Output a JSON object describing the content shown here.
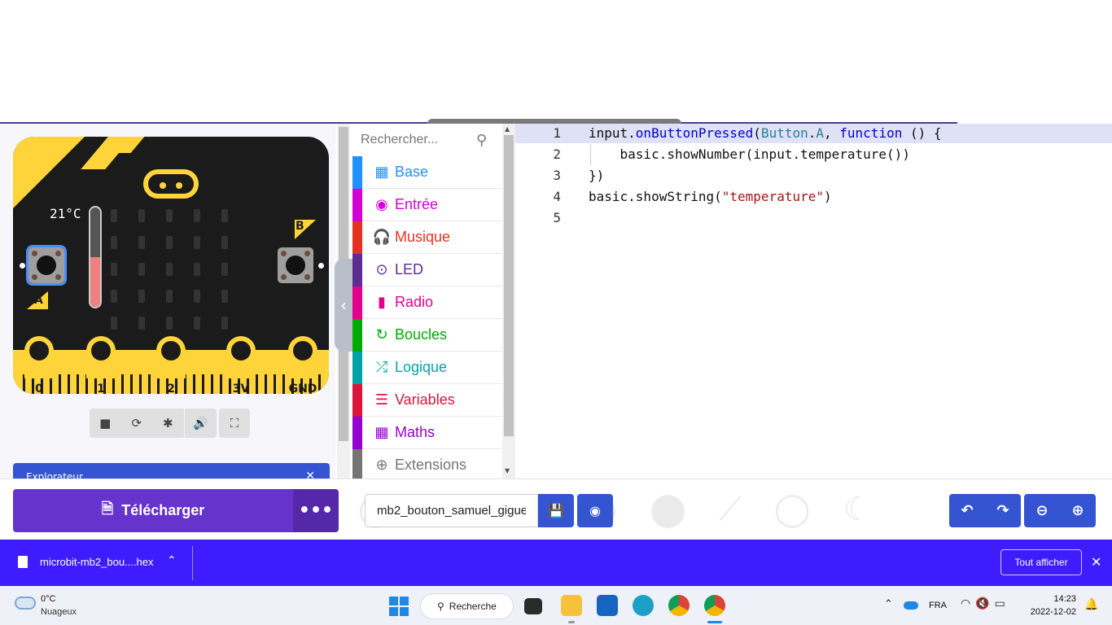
{
  "simulator": {
    "temperature_label": "21°C",
    "temperature_level": 0.5,
    "button_a_letter": "A",
    "button_b_letter": "B",
    "pins": [
      "0",
      "1",
      "2",
      "3V",
      "GND"
    ],
    "explorer_label": "Explorateur",
    "controls": [
      "stop-icon",
      "restart-icon",
      "debug-icon",
      "sound-icon",
      "fullscreen-icon"
    ]
  },
  "toolbox": {
    "search_placeholder": "Rechercher...",
    "categories": [
      {
        "label": "Base",
        "color": "#1e90ff",
        "icon": "grid-icon"
      },
      {
        "label": "Entrée",
        "color": "#d400d4",
        "icon": "input-icon"
      },
      {
        "label": "Musique",
        "color": "#e63022",
        "icon": "headphones-icon"
      },
      {
        "label": "LED",
        "color": "#5c2d91",
        "icon": "toggle-icon"
      },
      {
        "label": "Radio",
        "color": "#e3008c",
        "icon": "signal-icon"
      },
      {
        "label": "Boucles",
        "color": "#00aa00",
        "icon": "loop-icon"
      },
      {
        "label": "Logique",
        "color": "#00a4a6",
        "icon": "shuffle-icon"
      },
      {
        "label": "Variables",
        "color": "#dc143c",
        "icon": "list-icon"
      },
      {
        "label": "Maths",
        "color": "#9400d3",
        "icon": "calculator-icon"
      },
      {
        "label": "Extensions",
        "color": "#757575",
        "icon": "plus-circle-icon"
      }
    ]
  },
  "editor": {
    "lines": [
      {
        "n": "1",
        "parts": [
          [
            "input.",
            ""
          ],
          [
            "onButtonPressed",
            "fn"
          ],
          [
            "(",
            ""
          ],
          [
            "Button",
            "enum"
          ],
          [
            ".",
            ""
          ],
          [
            "A",
            "enum"
          ],
          [
            ", ",
            ""
          ],
          [
            "function",
            "fn"
          ],
          [
            " () {",
            ""
          ]
        ]
      },
      {
        "n": "2",
        "parts": [
          [
            "    basic.showNumber(input.temperature())",
            ""
          ]
        ]
      },
      {
        "n": "3",
        "parts": [
          [
            "})",
            ""
          ]
        ]
      },
      {
        "n": "4",
        "parts": [
          [
            "basic.showString(",
            ""
          ],
          [
            "\"temperature\"",
            "str"
          ],
          [
            ")",
            ""
          ]
        ]
      },
      {
        "n": "5",
        "parts": [
          [
            "",
            ""
          ]
        ]
      }
    ]
  },
  "actions": {
    "download_label": "Télécharger",
    "more_label": "•••",
    "project_name": "mb2_bouton_samuel_gigue"
  },
  "download_bar": {
    "file_name": "microbit-mb2_bou....hex",
    "show_all_label": "Tout afficher"
  },
  "taskbar": {
    "weather_temp": "0°C",
    "weather_desc": "Nuageux",
    "search_label": "Recherche",
    "lang": "FRA",
    "time": "14:23",
    "date": "2022-12-02"
  },
  "colors": {
    "download_button": "#6633cc",
    "accent_blue": "#3454d1",
    "download_bar": "#3f1bff",
    "board_yellow": "#ffd43b"
  }
}
